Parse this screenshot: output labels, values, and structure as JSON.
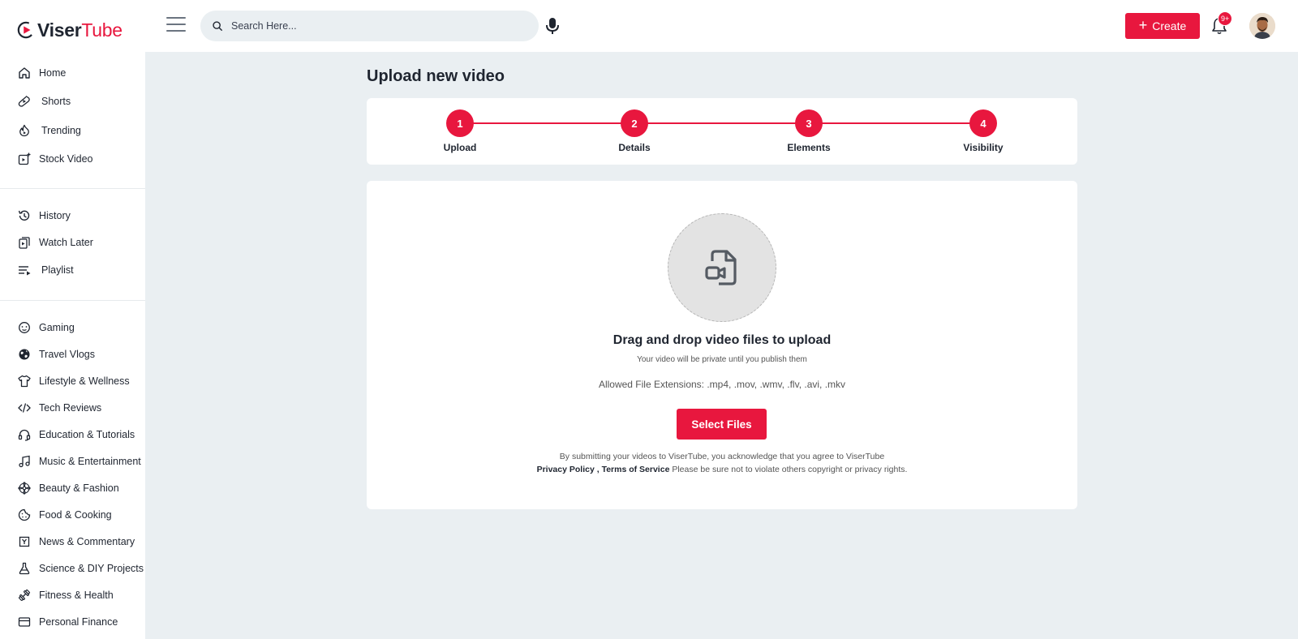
{
  "header": {
    "logo_part1": "Viser",
    "logo_part2": "Tube",
    "search_placeholder": "Search Here...",
    "create_label": "Create",
    "notification_badge": "9+",
    "brand_color": "#e8173e"
  },
  "sidebar": {
    "main": [
      {
        "label": "Home",
        "icon": "home-icon"
      },
      {
        "label": "Shorts",
        "icon": "shorts-icon"
      },
      {
        "label": "Trending",
        "icon": "trending-icon"
      },
      {
        "label": "Stock Video",
        "icon": "stock-video-icon"
      }
    ],
    "library": [
      {
        "label": "History",
        "icon": "history-icon"
      },
      {
        "label": "Watch Later",
        "icon": "watch-later-icon"
      },
      {
        "label": "Playlist",
        "icon": "playlist-icon"
      }
    ],
    "categories": [
      {
        "label": "Gaming",
        "icon": "gaming-icon"
      },
      {
        "label": "Travel Vlogs",
        "icon": "globe-icon"
      },
      {
        "label": "Lifestyle & Wellness",
        "icon": "shirt-icon"
      },
      {
        "label": "Tech Reviews",
        "icon": "code-icon"
      },
      {
        "label": "Education & Tutorials",
        "icon": "headset-icon"
      },
      {
        "label": "Music & Entertainment",
        "icon": "music-icon"
      },
      {
        "label": "Beauty & Fashion",
        "icon": "flower-icon"
      },
      {
        "label": "Food & Cooking",
        "icon": "cookie-icon"
      },
      {
        "label": "News & Commentary",
        "icon": "news-icon"
      },
      {
        "label": "Science & DIY Projects",
        "icon": "flask-icon"
      },
      {
        "label": "Fitness & Health",
        "icon": "dumbbell-icon"
      },
      {
        "label": "Personal Finance",
        "icon": "card-icon"
      }
    ]
  },
  "main": {
    "title": "Upload new video",
    "steps": [
      {
        "number": "1",
        "label": "Upload"
      },
      {
        "number": "2",
        "label": "Details"
      },
      {
        "number": "3",
        "label": "Elements"
      },
      {
        "number": "4",
        "label": "Visibility"
      }
    ],
    "upload": {
      "title": "Drag and drop video files to upload",
      "subtitle": "Your video will be private until you publish them",
      "extensions": "Allowed File Extensions: .mp4, .mov, .wmv, .flv, .avi, .mkv",
      "select_label": "Select Files",
      "legal_line1": "By submitting your videos to ViserTube, you acknowledge that you agree to ViserTube",
      "privacy_link": "Privacy Policy",
      "separator": ",",
      "terms_link": "Terms of Service",
      "legal_tail": "Please be sure not to violate others copyright or privacy rights."
    }
  }
}
